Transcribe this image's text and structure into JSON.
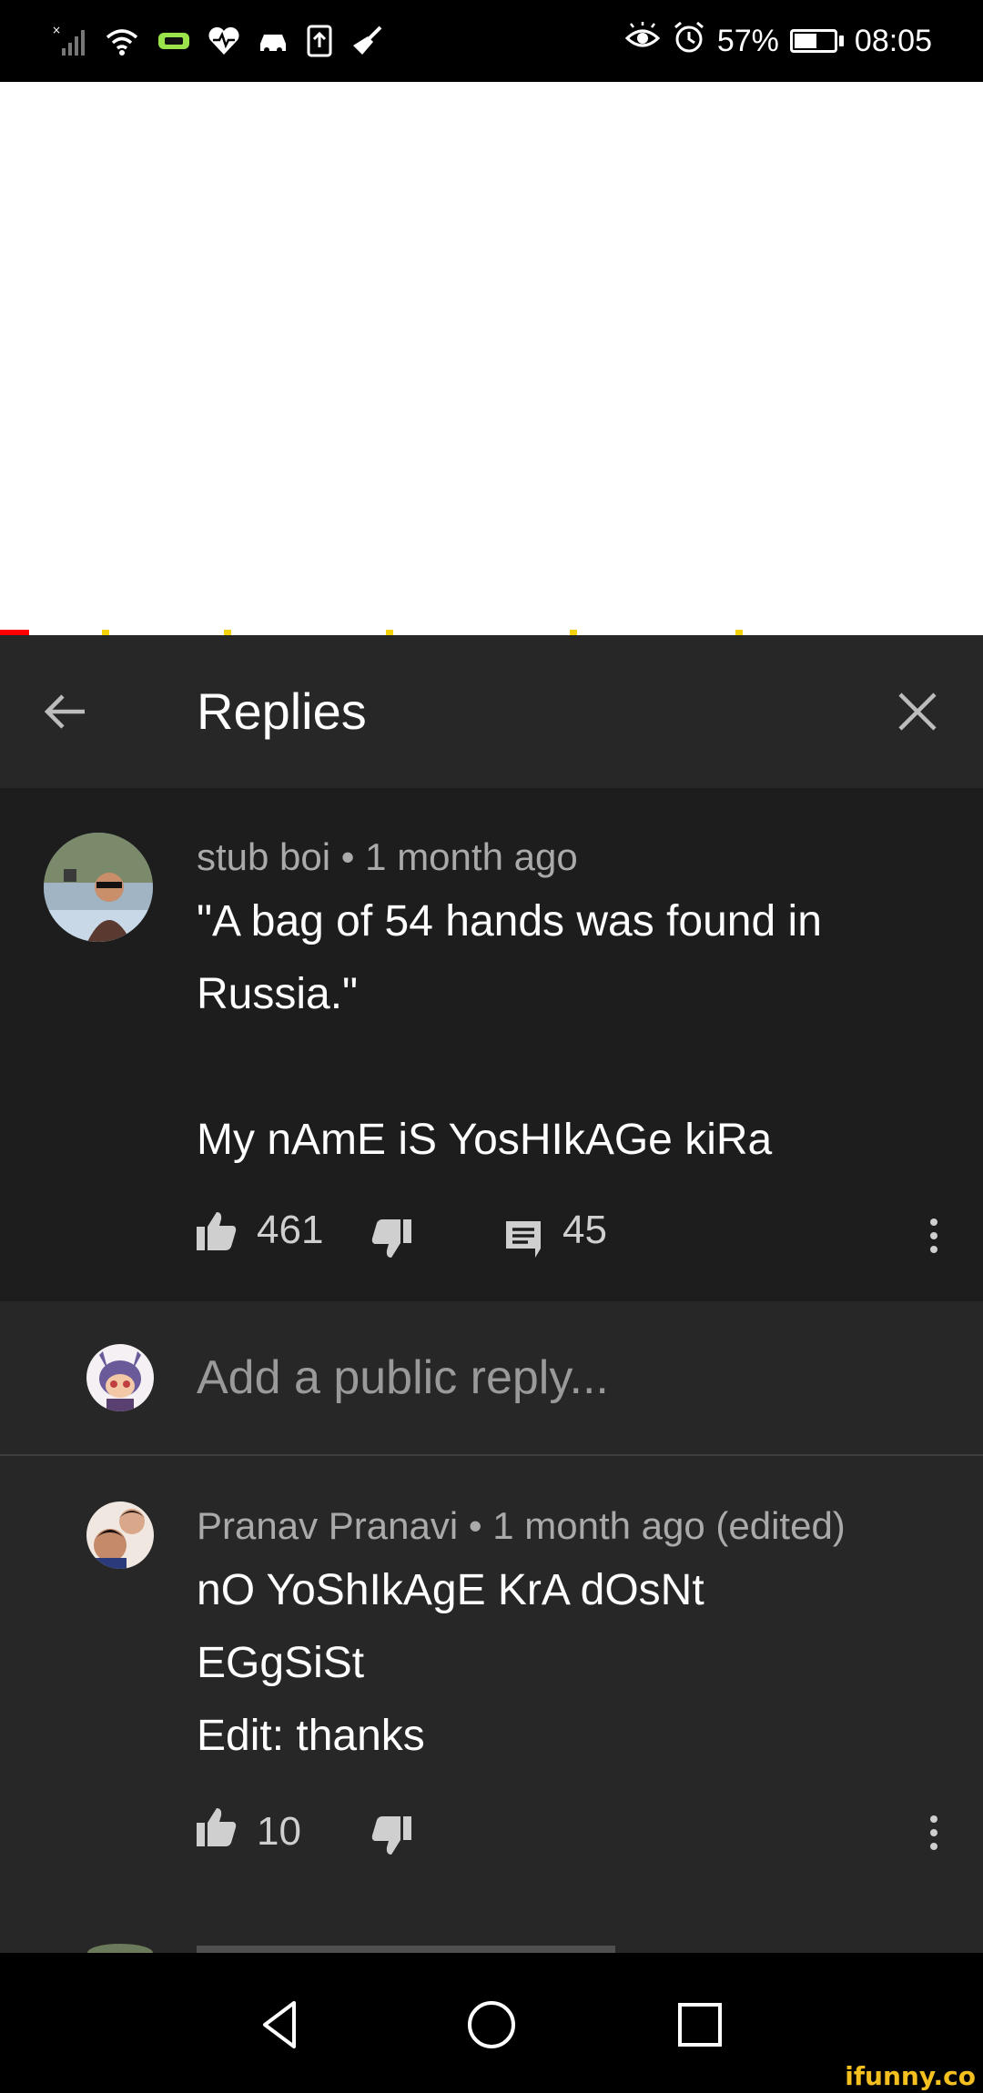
{
  "status_bar": {
    "battery_percent": "57%",
    "battery_level": 0.57,
    "time": "08:05",
    "left_icons": [
      "signal-x-icon",
      "wifi-icon",
      "game-icon",
      "heart-icon",
      "car-icon",
      "upload-icon",
      "broom-icon"
    ],
    "right_icons": [
      "eye-icon",
      "alarm-icon",
      "battery-icon"
    ]
  },
  "video": {
    "progress": 0.03,
    "background": "#ffffff",
    "progress_color": "#ff0000",
    "ad_marker_color": "#f3d20a"
  },
  "panel": {
    "title": "Replies",
    "background": "#272727"
  },
  "main_comment": {
    "author": "stub boi",
    "separator": "•",
    "time": "1 month ago",
    "text": "\"A bag of 54 hands was found in Russia.\"\n\nMy nAmE iS YosHIkAGe kiRa",
    "likes": "461",
    "replies": "45",
    "background": "#1d1d1d"
  },
  "reply_box": {
    "placeholder": "Add a public reply..."
  },
  "replies": [
    {
      "author": "Pranav Pranavi",
      "separator": "•",
      "time": "1 month ago (edited)",
      "text": "nO YoShIkAgE KrA dOsNt\nEGgSiSt\nEdit: thanks",
      "likes": "10"
    }
  ],
  "nav_bar": {
    "buttons": [
      "back-triangle-icon",
      "home-circle-icon",
      "recents-square-icon"
    ]
  },
  "watermark": "ifunny.co"
}
